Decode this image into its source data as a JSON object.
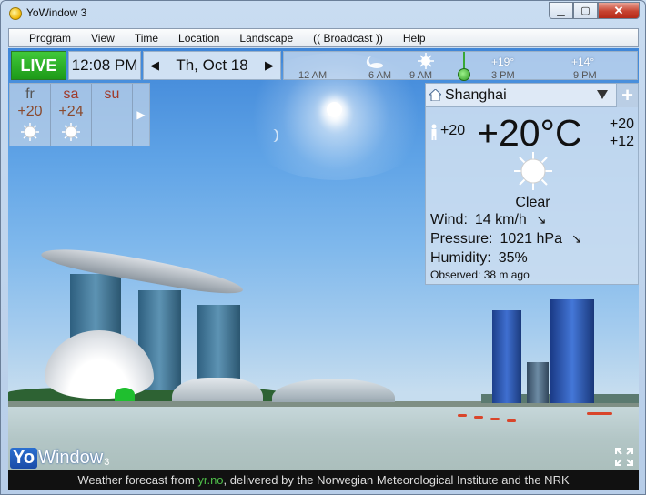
{
  "window": {
    "title": "YoWindow 3",
    "min": "▁",
    "max": "▢",
    "close": "✕"
  },
  "menu": [
    "Program",
    "View",
    "Time",
    "Location",
    "Landscape",
    "(( Broadcast ))",
    "Help"
  ],
  "live": {
    "label": "LIVE",
    "time": "12:08 PM",
    "date": "Th, Oct 18",
    "prev": "◀",
    "next": "▶"
  },
  "timeline": {
    "labels": [
      "12 AM",
      "6 AM",
      "9 AM",
      "3 PM",
      "9 PM"
    ],
    "temps": [
      "+19°",
      "+14°"
    ],
    "icons": [
      "moon-cloud-icon",
      "sun-icon"
    ]
  },
  "forecast": {
    "days": [
      {
        "name": "fr",
        "temp": "+20",
        "name_color": "#555555"
      },
      {
        "name": "sa",
        "temp": "+24",
        "name_color": "#a03a2a"
      },
      {
        "name": "su",
        "temp": "",
        "name_color": "#a03a2a"
      }
    ],
    "more": "▶"
  },
  "current": {
    "location": "Shanghai",
    "add": "+",
    "feels_like": "+20",
    "temperature": "+20°C",
    "high": "+20",
    "low": "+12",
    "condition": "Clear",
    "wind_label": "Wind:",
    "wind_value": "14 km/h",
    "wind_arrow": "↘",
    "pressure_label": "Pressure:",
    "pressure_value": "1021 hPa",
    "pressure_arrow": "↘",
    "humidity_label": "Humidity:",
    "humidity_value": "35%",
    "observed_label": "Observed:",
    "observed_value": "38 m ago"
  },
  "logo": {
    "box": "Yo",
    "text": "Window",
    "sub": "3"
  },
  "footer": {
    "prefix": "Weather forecast from ",
    "link": "yr.no",
    "suffix": ", delivered by the Norwegian Meteorological Institute and the NRK"
  },
  "colors": {
    "live_green": "#1d9a18",
    "link_green": "#4fbf4a",
    "temp_brown": "#8a4a2f"
  }
}
